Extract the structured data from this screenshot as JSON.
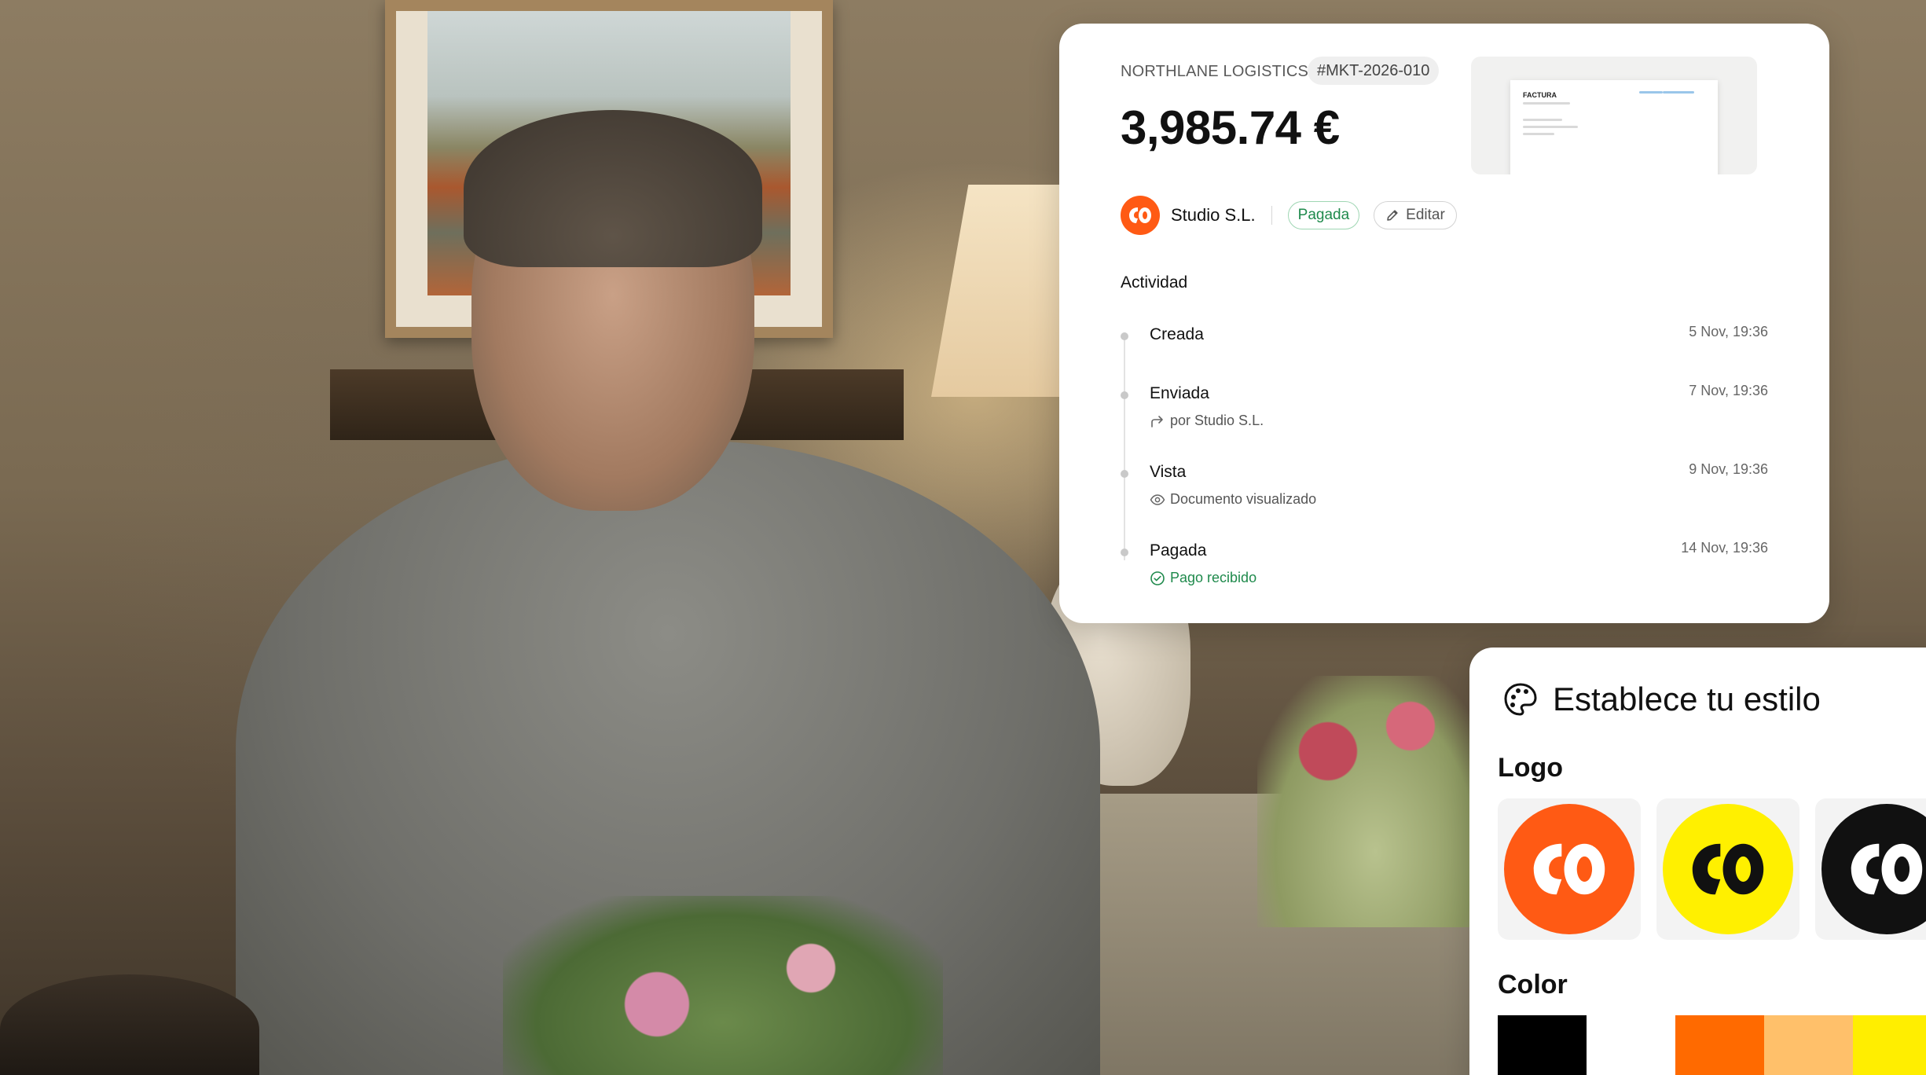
{
  "invoice": {
    "company": "NORTHLANE LOGISTICS",
    "id": "#MKT-2026-010",
    "amount": "3,985.74 €",
    "preview_heading": "FACTURA",
    "client": {
      "name": "Studio S.L.",
      "logo_icon": "studio-logo-icon",
      "brand_color": "#ff5a14"
    },
    "status": "Pagada",
    "status_color": "#1f8a4c",
    "edit_label": "Editar",
    "activity_title": "Actividad",
    "events": [
      {
        "title": "Creada",
        "time": "5 Nov, 19:36"
      },
      {
        "title": "Enviada",
        "time": "7 Nov, 19:36",
        "sub": "por Studio S.L.",
        "sub_icon": "forward-arrow-icon"
      },
      {
        "title": "Vista",
        "time": "9 Nov, 19:36",
        "sub": "Documento visualizado",
        "sub_icon": "eye-icon"
      },
      {
        "title": "Pagada",
        "time": "14 Nov, 19:36",
        "sub": "Pago recibido",
        "sub_icon": "check-circle-icon"
      }
    ]
  },
  "style_panel": {
    "title": "Establece tu estilo",
    "title_icon": "palette-icon",
    "logo_label": "Logo",
    "logo_options": [
      {
        "name": "orange-logo",
        "bg": "#ff5a14",
        "fg": "#ffffff"
      },
      {
        "name": "yellow-logo",
        "bg": "#fff000",
        "fg": "#111111"
      },
      {
        "name": "black-logo",
        "bg": "#111111",
        "fg": "#ffffff"
      }
    ],
    "color_label": "Color",
    "colors": [
      "#000000",
      "#ffffff",
      "#ff6a00",
      "#ffc06a",
      "#ffee00"
    ]
  }
}
